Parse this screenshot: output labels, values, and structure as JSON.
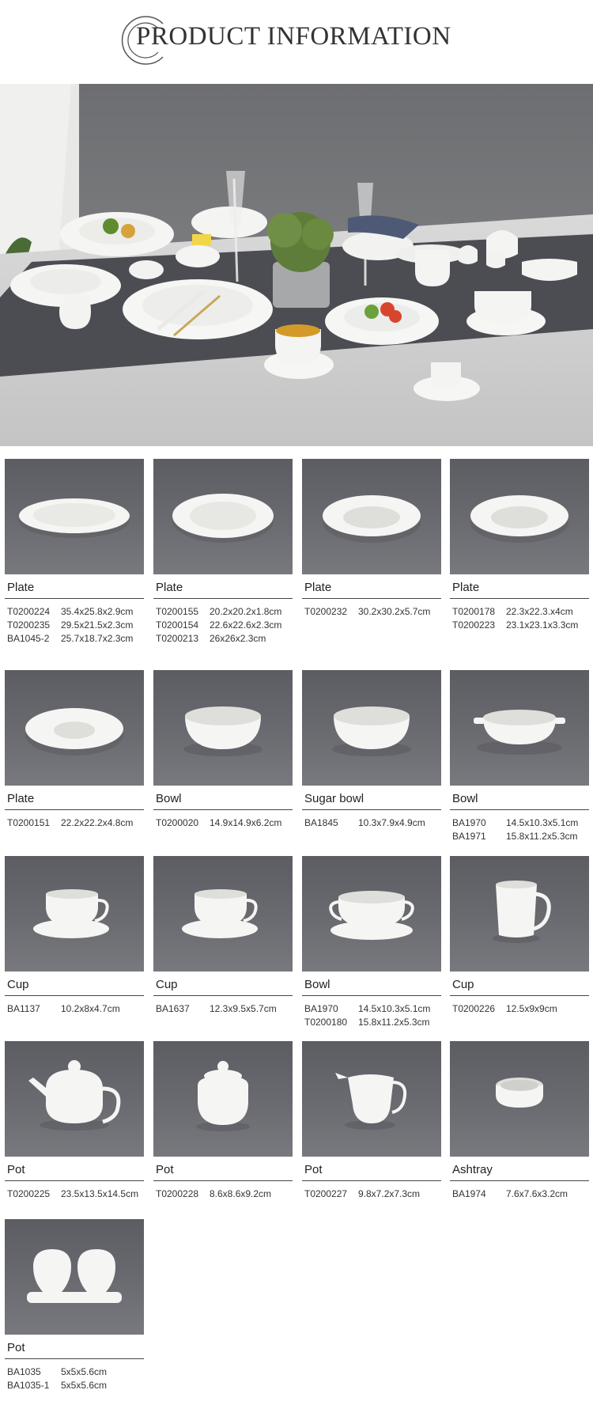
{
  "header": {
    "title": "PRODUCT INFORMATION"
  },
  "colors": {
    "photo_bg": "#66676c",
    "porcelain": "#f4f4f2",
    "text": "#222222"
  },
  "products": [
    {
      "name": "Plate",
      "image": "flat-plate",
      "specs": [
        {
          "code": "T0200224",
          "size": "35.4x25.8x2.9cm"
        },
        {
          "code": "T0200235",
          "size": "29.5x21.5x2.3cm"
        },
        {
          "code": "BA1045-2",
          "size": "25.7x18.7x2.3cm"
        }
      ]
    },
    {
      "name": "Plate",
      "image": "rim-plate",
      "specs": [
        {
          "code": "T0200155",
          "size": "20.2x20.2x1.8cm"
        },
        {
          "code": "T0200154",
          "size": "22.6x22.6x2.3cm"
        },
        {
          "code": "T0200213",
          "size": "26x26x2.3cm"
        }
      ]
    },
    {
      "name": "Plate",
      "image": "deep-plate",
      "specs": [
        {
          "code": "T0200232",
          "size": "30.2x30.2x5.7cm"
        }
      ]
    },
    {
      "name": "Plate",
      "image": "deep-plate",
      "specs": [
        {
          "code": "T0200178",
          "size": "22.3x22.3.x4cm"
        },
        {
          "code": "T0200223",
          "size": "23.1x23.1x3.3cm"
        }
      ]
    },
    {
      "name": "Plate",
      "image": "wide-rim-bowl",
      "specs": [
        {
          "code": "T0200151",
          "size": "22.2x22.2x4.8cm"
        }
      ]
    },
    {
      "name": "Bowl",
      "image": "bowl",
      "specs": [
        {
          "code": "T0200020",
          "size": "14.9x14.9x6.2cm"
        }
      ]
    },
    {
      "name": "Sugar bowl",
      "image": "bowl",
      "specs": [
        {
          "code": "BA1845",
          "size": "10.3x7.9x4.9cm"
        }
      ]
    },
    {
      "name": "Bowl",
      "image": "handled-bowl",
      "specs": [
        {
          "code": "BA1970",
          "size": "14.5x10.3x5.1cm"
        },
        {
          "code": "BA1971",
          "size": "15.8x11.2x5.3cm"
        }
      ]
    },
    {
      "name": "Cup",
      "image": "cup-saucer",
      "specs": [
        {
          "code": "BA1137",
          "size": "10.2x8x4.7cm"
        }
      ]
    },
    {
      "name": "Cup",
      "image": "cup-saucer",
      "specs": [
        {
          "code": "BA1637",
          "size": "12.3x9.5x5.7cm"
        }
      ]
    },
    {
      "name": "Bowl",
      "image": "soup-cup-saucer",
      "specs": [
        {
          "code": "BA1970",
          "size": "14.5x10.3x5.1cm"
        },
        {
          "code": "T0200180",
          "size": "15.8x11.2x5.3cm"
        }
      ]
    },
    {
      "name": "Cup",
      "image": "mug",
      "specs": [
        {
          "code": "T0200226",
          "size": "12.5x9x9cm"
        }
      ]
    },
    {
      "name": "Pot",
      "image": "teapot",
      "specs": [
        {
          "code": "T0200225",
          "size": "23.5x13.5x14.5cm"
        }
      ]
    },
    {
      "name": "Pot",
      "image": "sugar-pot",
      "specs": [
        {
          "code": "T0200228",
          "size": "8.6x8.6x9.2cm"
        }
      ]
    },
    {
      "name": "Pot",
      "image": "creamer",
      "specs": [
        {
          "code": "T0200227",
          "size": "9.8x7.2x7.3cm"
        }
      ]
    },
    {
      "name": "Ashtray",
      "image": "ashtray",
      "specs": [
        {
          "code": "BA1974",
          "size": "7.6x7.6x3.2cm"
        }
      ]
    },
    {
      "name": "Pot",
      "image": "salt-pepper",
      "specs": [
        {
          "code": "BA1035",
          "size": "5x5x5.6cm"
        },
        {
          "code": "BA1035-1",
          "size": "5x5x5.6cm"
        }
      ]
    }
  ]
}
